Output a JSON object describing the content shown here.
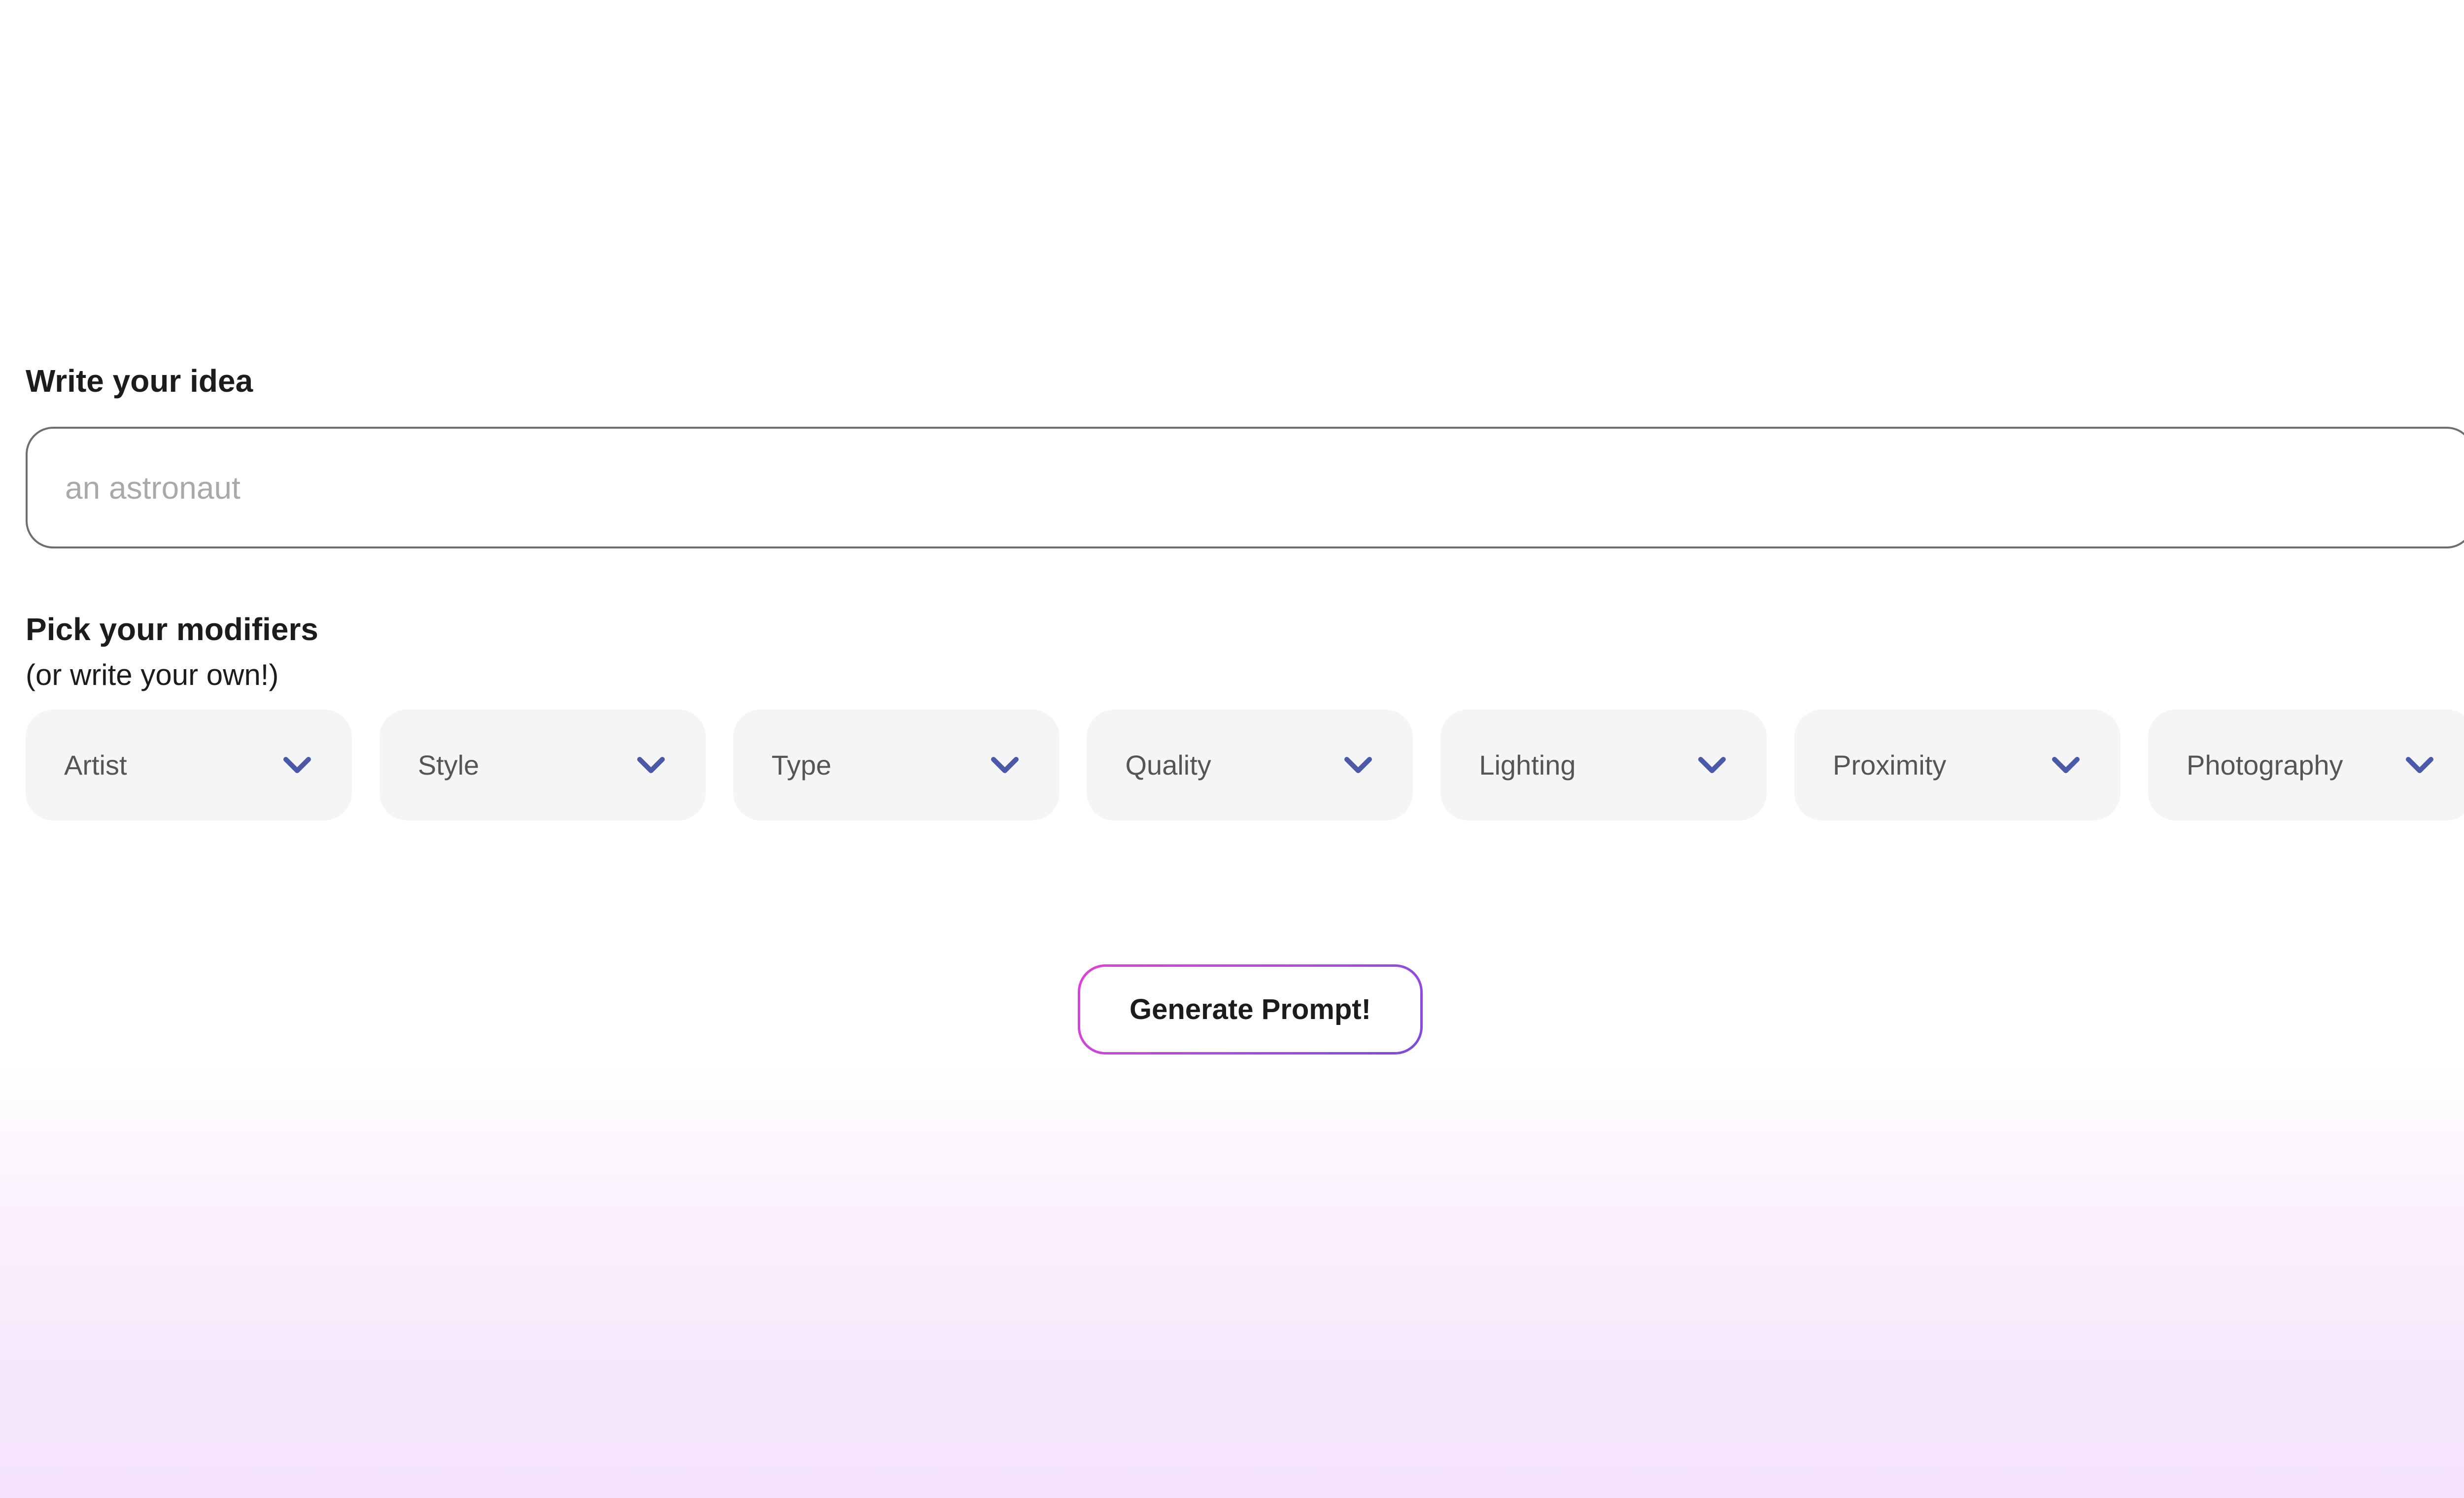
{
  "idea": {
    "heading": "Write your idea",
    "placeholder": "an astronaut",
    "value": ""
  },
  "modifiers": {
    "heading": "Pick your modifiers",
    "subheading": "(or write your own!)",
    "items": [
      {
        "label": "Artist",
        "icon": "chevron-down-icon"
      },
      {
        "label": "Style",
        "icon": "chevron-down-icon"
      },
      {
        "label": "Type",
        "icon": "chevron-down-icon"
      },
      {
        "label": "Quality",
        "icon": "chevron-down-icon"
      },
      {
        "label": "Lighting",
        "icon": "chevron-down-icon"
      },
      {
        "label": "Proximity",
        "icon": "chevron-down-icon"
      },
      {
        "label": "Photography",
        "icon": "chevron-down-icon"
      }
    ]
  },
  "actions": {
    "generate_label": "Generate Prompt!"
  },
  "colors": {
    "chevron": "#4a5aa8",
    "button_border_start": "#e040d8",
    "button_border_end": "#7b4cd6",
    "dropdown_bg": "#f5f5f5",
    "bottom_gradient": "#f4e2fb"
  }
}
